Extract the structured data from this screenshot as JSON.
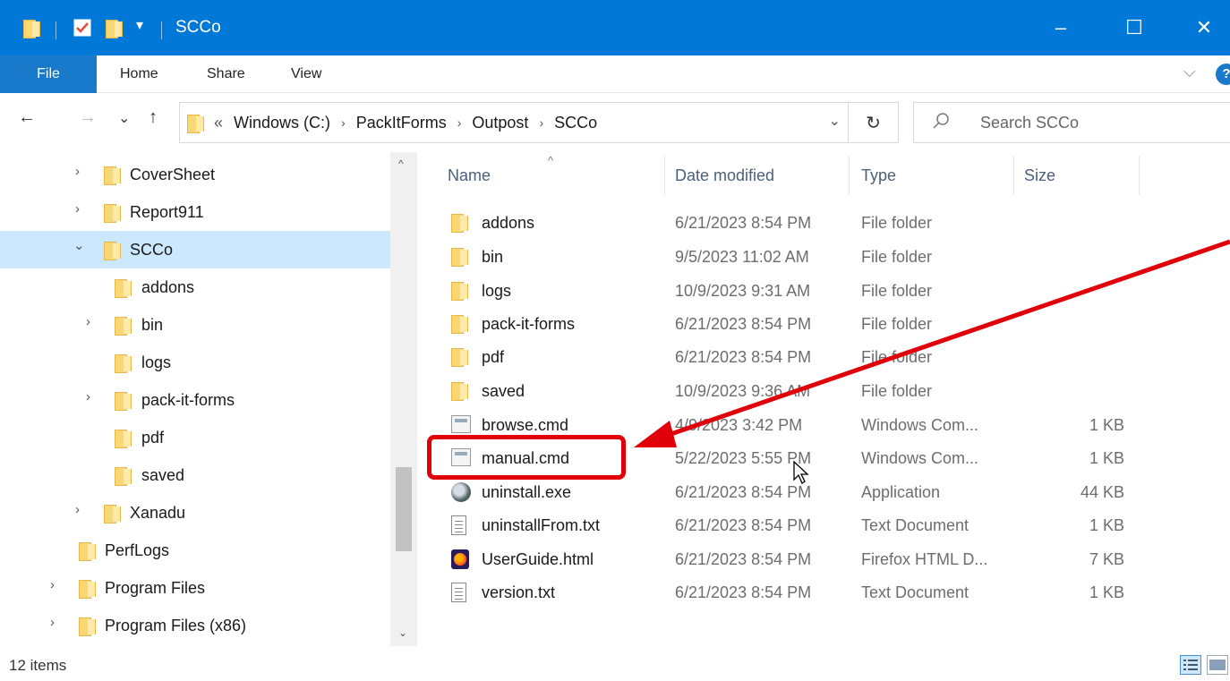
{
  "window": {
    "title": "SCCo",
    "minimize_glyph": "–",
    "maximize_glyph": "☐",
    "close_glyph": "✕",
    "quick_access_dropdown_glyph": "▾"
  },
  "ribbon": {
    "tabs": [
      "File",
      "Home",
      "Share",
      "View"
    ],
    "collapse_glyph": "⌵",
    "help_glyph": "?"
  },
  "address": {
    "back_glyph": "←",
    "forward_glyph": "→",
    "recent_glyph": "⌄",
    "up_glyph": "↑",
    "overflow_glyph": "«",
    "crumbs": [
      "Windows (C:)",
      "PackItForms",
      "Outpost",
      "SCCo"
    ],
    "crumb_separator": "›",
    "dropdown_glyph": "⌄",
    "refresh_glyph": "↻"
  },
  "search": {
    "placeholder": "Search SCCo"
  },
  "nav": {
    "expand_glyph": "›",
    "expanded_glyph": "⌄",
    "scroll_up_glyph": "^",
    "scroll_down_glyph": "⌄",
    "items": [
      {
        "label": "CoverSheet"
      },
      {
        "label": "Report911"
      },
      {
        "label": "SCCo"
      },
      {
        "label": "addons"
      },
      {
        "label": "bin"
      },
      {
        "label": "logs"
      },
      {
        "label": "pack-it-forms"
      },
      {
        "label": "pdf"
      },
      {
        "label": "saved"
      },
      {
        "label": "Xanadu"
      },
      {
        "label": "PerfLogs"
      },
      {
        "label": "Program Files"
      },
      {
        "label": "Program Files (x86)"
      }
    ]
  },
  "columns": {
    "name": "Name",
    "date": "Date modified",
    "type": "Type",
    "size": "Size",
    "sort_glyph": "^"
  },
  "files": [
    {
      "name": "addons",
      "date": "6/21/2023 8:54 PM",
      "type": "File folder",
      "size": "",
      "icon": "folder-icon"
    },
    {
      "name": "bin",
      "date": "9/5/2023 11:02 AM",
      "type": "File folder",
      "size": "",
      "icon": "folder-icon"
    },
    {
      "name": "logs",
      "date": "10/9/2023 9:31 AM",
      "type": "File folder",
      "size": "",
      "icon": "folder-icon"
    },
    {
      "name": "pack-it-forms",
      "date": "6/21/2023 8:54 PM",
      "type": "File folder",
      "size": "",
      "icon": "folder-icon"
    },
    {
      "name": "pdf",
      "date": "6/21/2023 8:54 PM",
      "type": "File folder",
      "size": "",
      "icon": "folder-icon"
    },
    {
      "name": "saved",
      "date": "10/9/2023 9:36 AM",
      "type": "File folder",
      "size": "",
      "icon": "folder-icon"
    },
    {
      "name": "browse.cmd",
      "date": "4/9/2023 3:42 PM",
      "type": "Windows Com...",
      "size": "1 KB",
      "icon": "cmd-file-icon"
    },
    {
      "name": "manual.cmd",
      "date": "5/22/2023 5:55 PM",
      "type": "Windows Com...",
      "size": "1 KB",
      "icon": "cmd-file-icon"
    },
    {
      "name": "uninstall.exe",
      "date": "6/21/2023 8:54 PM",
      "type": "Application",
      "size": "44 KB",
      "icon": "exe-file-icon"
    },
    {
      "name": "uninstallFrom.txt",
      "date": "6/21/2023 8:54 PM",
      "type": "Text Document",
      "size": "1 KB",
      "icon": "text-file-icon"
    },
    {
      "name": "UserGuide.html",
      "date": "6/21/2023 8:54 PM",
      "type": "Firefox HTML D...",
      "size": "7 KB",
      "icon": "firefox-html-icon"
    },
    {
      "name": "version.txt",
      "date": "6/21/2023 8:54 PM",
      "type": "Text Document",
      "size": "1 KB",
      "icon": "text-file-icon"
    }
  ],
  "status": {
    "item_count": "12 items"
  },
  "colors": {
    "titlebar": "#0078d7",
    "selection": "#cce8ff",
    "annotation": "#e0000a",
    "folder": "#f8d775"
  }
}
